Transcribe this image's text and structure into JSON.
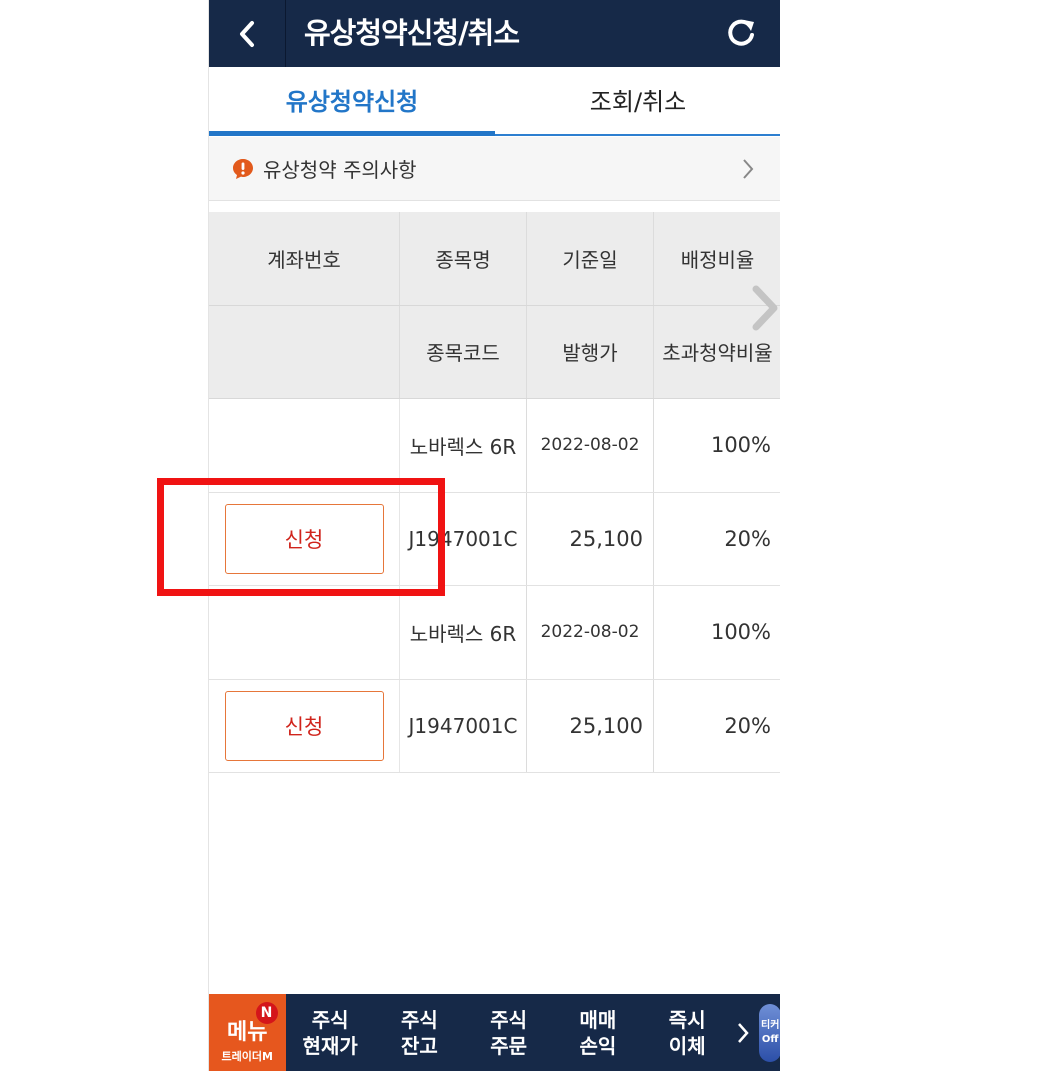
{
  "header": {
    "title": "유상청약신청/취소"
  },
  "tabs": [
    {
      "label": "유상청약신청",
      "active": true
    },
    {
      "label": "조회/취소",
      "active": false
    }
  ],
  "notice": {
    "text": "유상청약 주의사항"
  },
  "table": {
    "headers_row1": [
      "계좌번호",
      "종목명",
      "기준일",
      "배정비율"
    ],
    "headers_row2": [
      "",
      "종목코드",
      "발행가",
      "초과청약비율"
    ],
    "rows": [
      {
        "name": "노바렉스 6R",
        "date": "2022-08-02",
        "ratio": "100%",
        "button": "신청",
        "code": "J1947001C",
        "price": "25,100",
        "excess": "20%"
      },
      {
        "name": "노바렉스 6R",
        "date": "2022-08-02",
        "ratio": "100%",
        "button": "신청",
        "code": "J1947001C",
        "price": "25,100",
        "excess": "20%"
      }
    ]
  },
  "bottom_bar": {
    "menu_label": "메뉴",
    "menu_badge": "N",
    "menu_brand": "트레이더M",
    "links": [
      {
        "line1": "주식",
        "line2": "현재가"
      },
      {
        "line1": "주식",
        "line2": "잔고"
      },
      {
        "line1": "주식",
        "line2": "주문"
      },
      {
        "line1": "매매",
        "line2": "손익"
      },
      {
        "line1": "즉시",
        "line2": "이체"
      }
    ],
    "ticker_line1": "티커",
    "ticker_line2": "Off"
  },
  "colors": {
    "header_bg": "#162948",
    "tab_active": "#2276c8",
    "button_border": "#e6763a",
    "button_text": "#d0241c",
    "menu_bg": "#e6571e",
    "highlight": "#f01313"
  }
}
